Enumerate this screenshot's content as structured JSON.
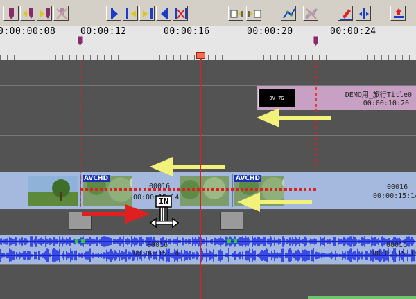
{
  "toolbar": {
    "buttons": [
      {
        "name": "mark-in-button",
        "icon": "marker-icon"
      },
      {
        "name": "prev-mark-button",
        "icon": "prev-marker-icon"
      },
      {
        "name": "next-mark-button",
        "icon": "next-marker-icon"
      },
      {
        "name": "delete-mark-button",
        "icon": "delete-marker-icon"
      },
      {
        "name": "set-in-button",
        "icon": "set-in-icon"
      },
      {
        "name": "jump-in-button",
        "icon": "jump-in-icon"
      },
      {
        "name": "jump-out-button",
        "icon": "jump-out-icon"
      },
      {
        "name": "set-out-button",
        "icon": "set-out-icon"
      },
      {
        "name": "clear-inout-button",
        "icon": "clear-inout-icon"
      },
      {
        "name": "add-clip-button",
        "icon": "film-add-icon"
      },
      {
        "name": "replace-clip-button",
        "icon": "film-replace-icon"
      },
      {
        "name": "rubber-band-button",
        "icon": "rubber-band-icon"
      },
      {
        "name": "clear-rubber-band-button",
        "icon": "rubber-band-clear-icon"
      },
      {
        "name": "pen-button",
        "icon": "pen-icon"
      },
      {
        "name": "split-button",
        "icon": "split-icon"
      },
      {
        "name": "export-button",
        "icon": "export-icon"
      }
    ]
  },
  "ruler": {
    "timecodes": [
      "0:00:00:08",
      "00:00:12",
      "00:00:16",
      "00:00:20",
      "00:00:24"
    ]
  },
  "title_clip": {
    "thumb_label": "DV-7G",
    "name": "DEMO用_旅行Title0",
    "duration": "00:00:10:20"
  },
  "video_clips": {
    "badge": "AVCHD",
    "clip1_frame": "00016",
    "clip1_time": "00:00:15:14",
    "clip2_frame": "00016",
    "clip2_time": "00:00:15:14"
  },
  "audio_clips": {
    "clip1_frame": "00016",
    "clip1_time": "00:00:15:14",
    "clip2_frame": "00016",
    "clip2_time": "00:00:15:14"
  },
  "cursor": {
    "label": "IN",
    "icon": "trim-cursor-icon"
  },
  "colors": {
    "clip_blue": "#a5b8dd",
    "title_pink": "#c8a0c3",
    "playhead": "#e02020",
    "marker": "#8a2a6a",
    "arrow_yellow": "#f2f27a",
    "arrow_red": "#e02020",
    "waveform": "#1f2ee6"
  }
}
